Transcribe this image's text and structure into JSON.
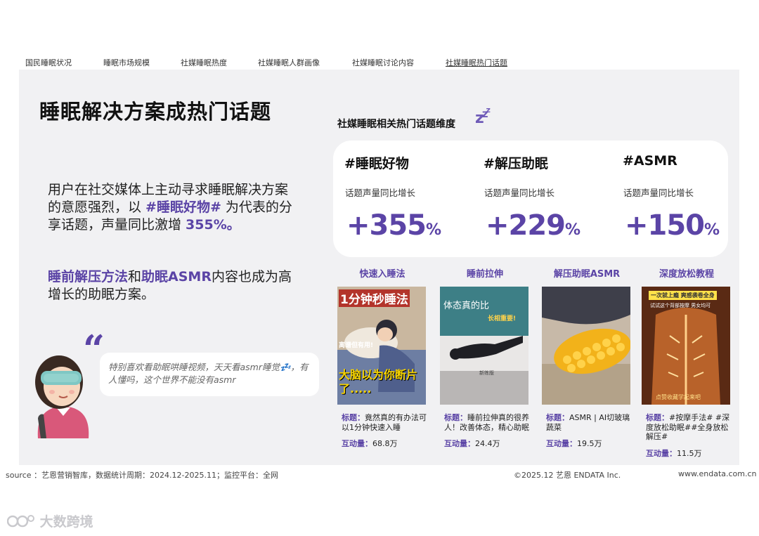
{
  "nav": {
    "items": [
      "国民睡眠状况",
      "睡眠市场规模",
      "社媒睡眠热度",
      "社媒睡眠人群画像",
      "社媒睡眠讨论内容",
      "社媒睡眠热门话题"
    ],
    "active_index": 5
  },
  "main": {
    "title": "睡眠解决方案成热门话题",
    "para1_a": "用户在社交媒体上主动寻求睡眠解决方案的意愿强烈，以 ",
    "para1_hl1": "#睡眠好物#",
    "para1_b": " 为代表的分享话题，声量同比激增 ",
    "para1_hl2": "355%。",
    "para2_hl1": "睡前解压方法",
    "para2_a": "和",
    "para2_hl2": "助眠ASMR",
    "para2_b": "内容也成为高增长的助眠方案。",
    "quote_mark": "“",
    "quote_text": "特别喜欢看助眠哄睡视频，天天看asmr睡觉💤，有人懂吗，这个世界不能没有asmr"
  },
  "topics": {
    "subtitle": "社媒睡眠相关热门话题维度",
    "items": [
      {
        "tag": "#睡眠好物",
        "label": "话题声量同比增长",
        "value": "+355",
        "unit": "%"
      },
      {
        "tag": "#解压助眠",
        "label": "话题声量同比增长",
        "value": "+229",
        "unit": "%"
      },
      {
        "tag": "#ASMR",
        "label": "话题声量同比增长",
        "value": "+150",
        "unit": "%"
      }
    ]
  },
  "cards": [
    {
      "head": "快速入睡法",
      "img_top": "1分钟秒睡法",
      "img_mid": "离谱但有用!",
      "img_bottom": "大脑以为你断片了.....",
      "title_key": "标题：",
      "title": "竟然真的有办法可以1分钟快速入睡",
      "inter_key": "互动量：",
      "inter": "68.8万"
    },
    {
      "head": "睡前拉伸",
      "img_top": "体态真的比",
      "img_mid": "长相重要!",
      "img_bottom": "新练版",
      "title_key": "标题：",
      "title": "睡前拉伸真的很养人！改善体态，精心助眠",
      "inter_key": "互动量：",
      "inter": "24.4万"
    },
    {
      "head": "解压助眠ASMR",
      "img_top": "",
      "img_mid": "",
      "img_bottom": "",
      "title_key": "标题：",
      "title": "ASMR | AI切玻璃蔬菜",
      "inter_key": "互动量：",
      "inter": "19.5万"
    },
    {
      "head": "深度放松教程",
      "img_top": "一次就上瘾 爽感袭卷全身",
      "img_mid": "试试这个背部按摩 男女均可",
      "img_bottom": "点赞收藏学起来吧",
      "title_key": "标题：",
      "title": "#按摩手法# #深度放松助眠##全身放松解压#",
      "inter_key": "互动量：",
      "inter": "11.5万"
    }
  ],
  "footer": {
    "source": "source ：艺恩营销智库，数据统计周期：2024.12-2025.11；监控平台：全网",
    "copyright": "©2025.12  艺恩 ENDATA Inc.",
    "website": "www.endata.com.cn"
  },
  "watermark": "大数跨境",
  "colors": {
    "accent": "#5b44a6",
    "panel": "#f1f1f3",
    "card": "#ffffff"
  }
}
